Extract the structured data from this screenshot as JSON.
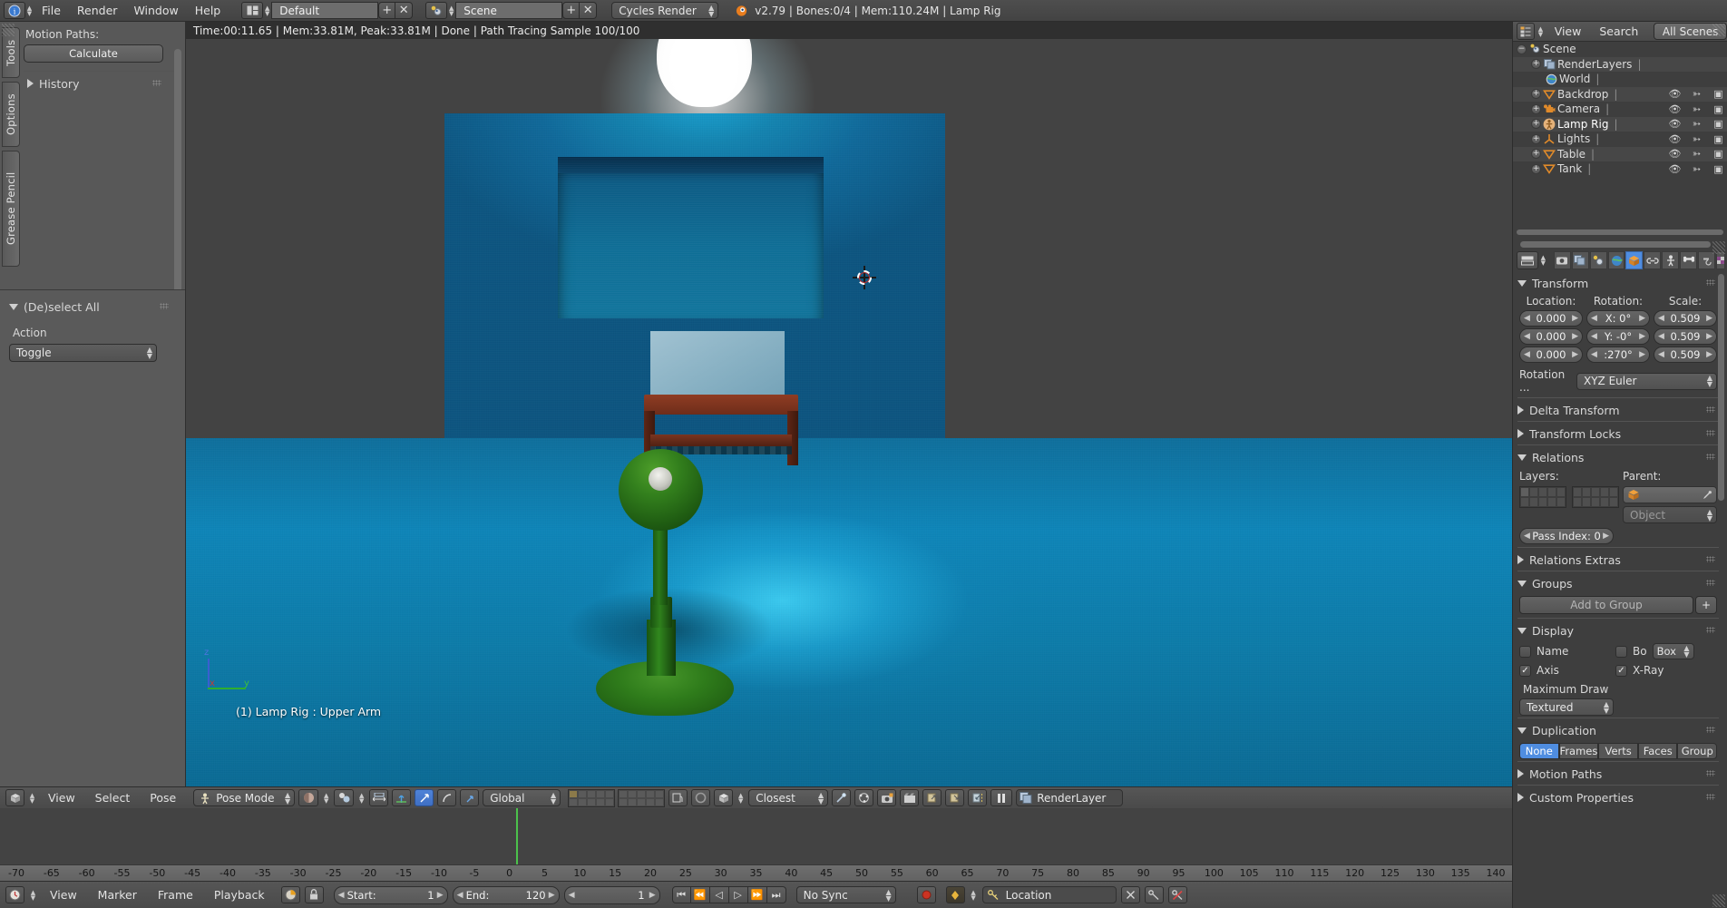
{
  "topbar": {
    "menus": [
      "File",
      "Render",
      "Window",
      "Help"
    ],
    "screen_layout": "Default",
    "scene_name": "Scene",
    "engine": "Cycles Render",
    "status": "v2.79 | Bones:0/4  | Mem:110.24M | Lamp Rig",
    "add_label": "+",
    "close_label": "✕"
  },
  "toolshelf": {
    "tabs": [
      "Tools",
      "Options",
      "Grease Pencil"
    ],
    "motion_paths_label": "Motion Paths:",
    "calculate_button": "Calculate",
    "history_label": "History",
    "operator_panel": {
      "title": "(De)select All",
      "action_label": "Action",
      "action_value": "Toggle"
    }
  },
  "viewport": {
    "render_info": "Time:00:11.65 | Mem:33.81M, Peak:33.81M | Done | Path Tracing Sample 100/100",
    "object_info": "(1) Lamp Rig : Upper Arm",
    "axis_labels": {
      "x": "x",
      "y": "y",
      "z": "z"
    },
    "header": {
      "menus": [
        "View",
        "Select",
        "Pose"
      ],
      "mode": "Pose Mode",
      "orientation": "Global",
      "snap_target": "Closest",
      "render_layer": "RenderLayer"
    }
  },
  "timeline": {
    "menus": [
      "View",
      "Marker",
      "Frame",
      "Playback"
    ],
    "start_label": "Start:",
    "start_value": "1",
    "end_label": "End:",
    "end_value": "120",
    "current_frame": "1",
    "sync_mode": "No Sync",
    "keying_set": "Location",
    "ticks": [
      "-70",
      "-65",
      "-60",
      "-55",
      "-50",
      "-45",
      "-40",
      "-35",
      "-30",
      "-25",
      "-20",
      "-15",
      "-10",
      "-5",
      "0",
      "5",
      "10",
      "15",
      "20",
      "25",
      "30",
      "35",
      "40",
      "45",
      "50",
      "55",
      "60",
      "65",
      "70",
      "75",
      "80",
      "85",
      "90",
      "95",
      "100",
      "105",
      "110",
      "115",
      "120",
      "125",
      "130",
      "135",
      "140"
    ],
    "playhead_frame": "1",
    "transport": [
      "⏮",
      "⏪",
      "◁",
      "▷",
      "⏩",
      "⏭"
    ]
  },
  "outliner": {
    "menus": [
      "View",
      "Search"
    ],
    "display_mode": "All Scenes",
    "rows": [
      {
        "label": "Scene",
        "indent": 0,
        "icon": "scene-icon",
        "expander": "−",
        "toggles": false
      },
      {
        "label": "RenderLayers",
        "indent": 1,
        "icon": "renderlayers-icon",
        "expander": "+",
        "toggles": false
      },
      {
        "label": "World",
        "indent": 1,
        "icon": "world-icon",
        "expander": "",
        "toggles": false
      },
      {
        "label": "Backdrop",
        "indent": 1,
        "icon": "mesh-icon",
        "expander": "+",
        "toggles": true
      },
      {
        "label": "Camera",
        "indent": 1,
        "icon": "camera-icon",
        "expander": "+",
        "toggles": true
      },
      {
        "label": "Lamp Rig",
        "indent": 1,
        "icon": "armature-icon",
        "expander": "+",
        "toggles": true
      },
      {
        "label": "Lights",
        "indent": 1,
        "icon": "empty-icon",
        "expander": "+",
        "toggles": true
      },
      {
        "label": "Table",
        "indent": 1,
        "icon": "mesh-icon",
        "expander": "+",
        "toggles": true
      },
      {
        "label": "Tank",
        "indent": 1,
        "icon": "mesh-icon",
        "expander": "+",
        "toggles": true
      }
    ]
  },
  "properties": {
    "tabs": [
      "render-icon",
      "renderlayers-icon",
      "scene-icon",
      "world-icon",
      "object-icon",
      "constraints-icon",
      "armature-icon",
      "bone-icon",
      "bone-constraint-icon",
      "texture-icon"
    ],
    "selected_tab_index": 4,
    "transform": {
      "title": "Transform",
      "location_label": "Location:",
      "rotation_label": "Rotation:",
      "scale_label": "Scale:",
      "location": [
        "0.000",
        "0.000",
        "0.000"
      ],
      "rotation": [
        "X:  0°",
        "Y:  -0°",
        ":270°"
      ],
      "scale": [
        "0.509",
        "0.509",
        "0.509"
      ],
      "rotation_mode_label": "Rotation ...",
      "rotation_mode_value": "XYZ Euler"
    },
    "delta_transform_title": "Delta Transform",
    "transform_locks_title": "Transform Locks",
    "relations": {
      "title": "Relations",
      "layers_label": "Layers:",
      "parent_label": "Parent:",
      "parent_value": "",
      "parent_type_value": "Object",
      "pass_index_label": "Pass Index:  0"
    },
    "relations_extras_title": "Relations Extras",
    "groups": {
      "title": "Groups",
      "add_to_group": "Add to Group"
    },
    "display": {
      "title": "Display",
      "name_label": "Name",
      "name_checked": false,
      "bo_label": "Bo",
      "bo_checked": false,
      "bounds_value": "Box",
      "axis_label": "Axis",
      "axis_checked": true,
      "xray_label": "X-Ray",
      "xray_checked": true,
      "maximum_draw_label": "Maximum Draw",
      "maximum_draw_value": "Textured"
    },
    "duplication": {
      "title": "Duplication",
      "options": [
        "None",
        "Frames",
        "Verts",
        "Faces",
        "Group"
      ],
      "selected": "None"
    },
    "motion_paths_title": "Motion Paths",
    "custom_properties_title": "Custom Properties"
  },
  "colors": {
    "accent_blue": "#4f8de0",
    "header_grey": "#4e4e4e",
    "panel_grey": "#3e3e3e",
    "wall_blue": "#10699a",
    "lamp_green": "#2f7c1b",
    "table_brown": "#6e2d1a"
  }
}
